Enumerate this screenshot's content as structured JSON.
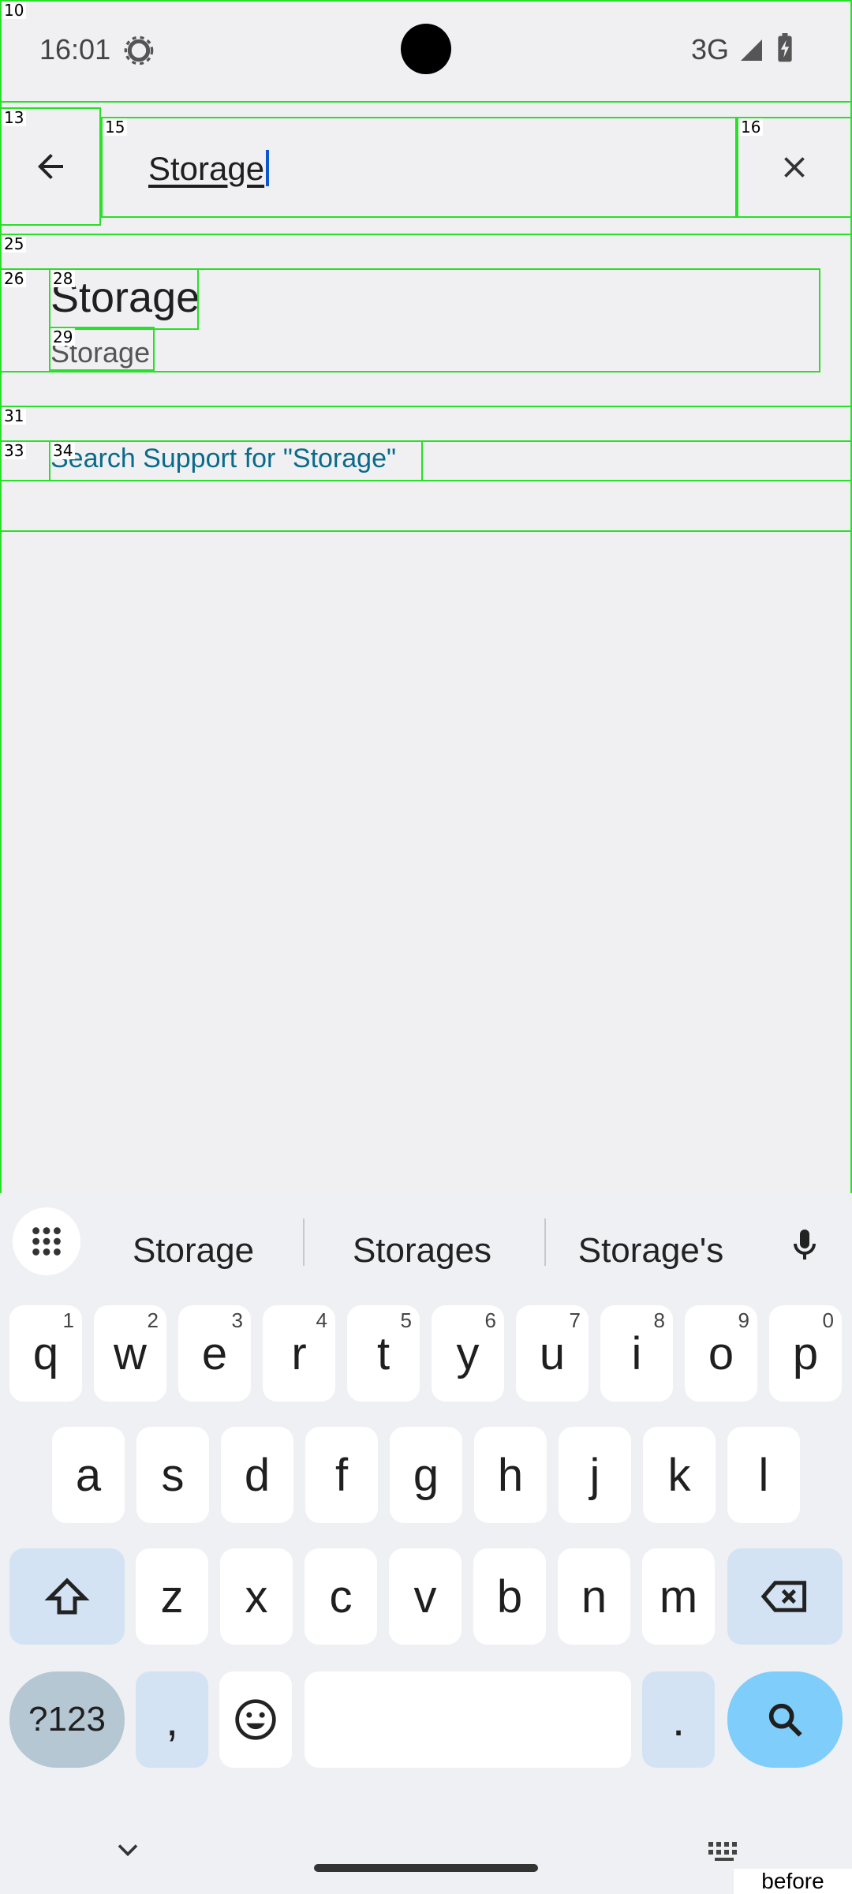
{
  "status_bar": {
    "time": "16:01",
    "network": "3G"
  },
  "search": {
    "query": "Storage"
  },
  "results": [
    {
      "title": "Storage",
      "subtitle": "Storage"
    }
  ],
  "support_link": "Search Support for \"Storage\"",
  "keyboard": {
    "suggestions": [
      "Storage",
      "Storages",
      "Storage's"
    ],
    "row1": [
      {
        "key": "q",
        "hint": "1"
      },
      {
        "key": "w",
        "hint": "2"
      },
      {
        "key": "e",
        "hint": "3"
      },
      {
        "key": "r",
        "hint": "4"
      },
      {
        "key": "t",
        "hint": "5"
      },
      {
        "key": "y",
        "hint": "6"
      },
      {
        "key": "u",
        "hint": "7"
      },
      {
        "key": "i",
        "hint": "8"
      },
      {
        "key": "o",
        "hint": "9"
      },
      {
        "key": "p",
        "hint": "0"
      }
    ],
    "row2": [
      "a",
      "s",
      "d",
      "f",
      "g",
      "h",
      "j",
      "k",
      "l"
    ],
    "row3": [
      "z",
      "x",
      "c",
      "v",
      "b",
      "n",
      "m"
    ],
    "symbols_label": "?123",
    "comma": ",",
    "period": "."
  },
  "overlay_label": "before",
  "box_labels": {
    "root": "10",
    "back": "13",
    "field": "15",
    "clear": "16",
    "results": "25",
    "row": "26",
    "title": "28",
    "sub": "29",
    "support_group": "31",
    "support_row": "33",
    "support_text": "34"
  }
}
